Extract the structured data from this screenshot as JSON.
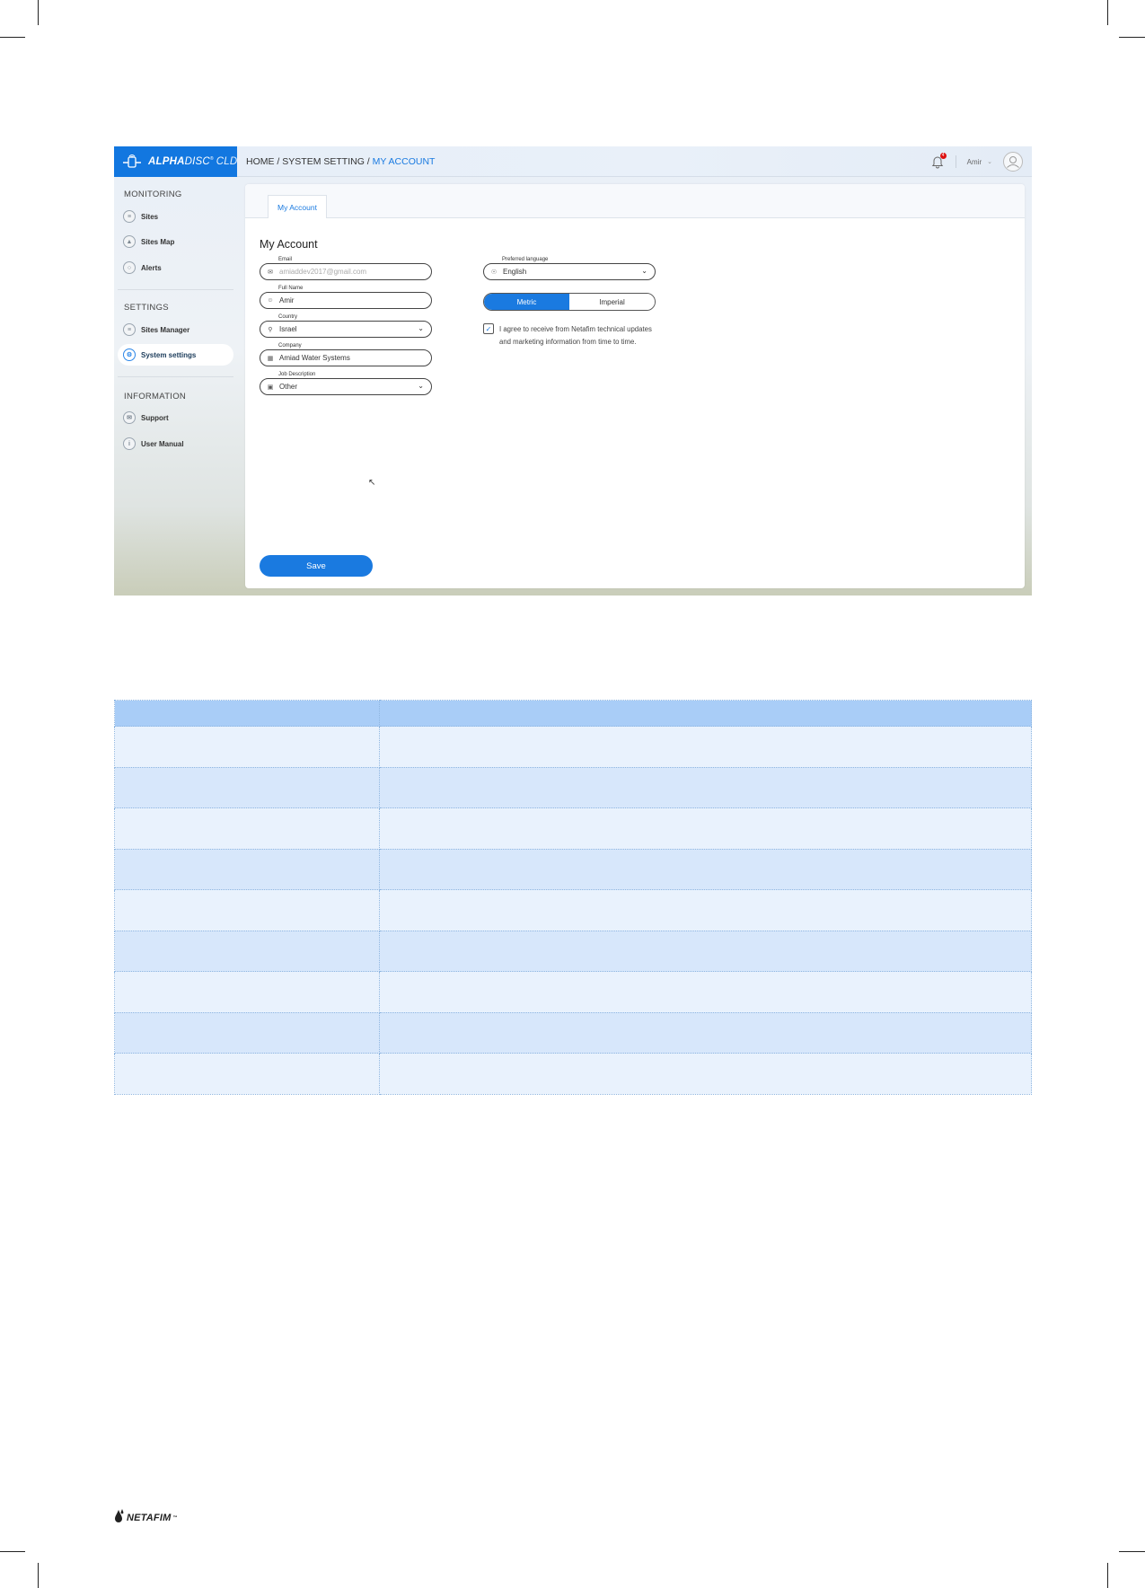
{
  "app": {
    "logo_bold": "ALPHA",
    "logo_disc": "DISC",
    "logo_reg": "®",
    "logo_cld": "CLD",
    "breadcrumb": {
      "home": "HOME",
      "sep1": "/",
      "system": "SYSTEM SETTING",
      "sep2": "/",
      "current": "MY ACCOUNT"
    },
    "notification_count": "4",
    "user_name": "Amir"
  },
  "sidebar": {
    "sections": [
      {
        "title": "MONITORING",
        "items": [
          {
            "label": "Sites",
            "icon": "layers-icon"
          },
          {
            "label": "Sites Map",
            "icon": "map-pin-icon"
          },
          {
            "label": "Alerts",
            "icon": "bell-icon"
          }
        ]
      },
      {
        "title": "SETTINGS",
        "items": [
          {
            "label": "Sites Manager",
            "icon": "layers-icon"
          },
          {
            "label": "System settings",
            "icon": "settings-icon"
          }
        ]
      },
      {
        "title": "INFORMATION",
        "items": [
          {
            "label": "Support",
            "icon": "chat-icon"
          },
          {
            "label": "User Manual",
            "icon": "info-icon"
          }
        ]
      }
    ],
    "selected": "System settings"
  },
  "main": {
    "tab": "My Account",
    "title": "My Account",
    "fields": {
      "email": {
        "label": "Email",
        "value": "amiaddev2017@gmail.com",
        "icon": "mail-icon"
      },
      "full_name": {
        "label": "Full Name",
        "value": "Amir",
        "icon": "user-icon"
      },
      "country": {
        "label": "Country",
        "value": "Israel",
        "icon": "location-icon"
      },
      "company": {
        "label": "Company",
        "value": "Amiad Water Systems",
        "icon": "building-icon"
      },
      "job": {
        "label": "Job Description",
        "value": "Other",
        "icon": "briefcase-icon"
      },
      "language": {
        "label": "Preferred language",
        "value": "English",
        "icon": "globe-icon"
      }
    },
    "units": {
      "metric": "Metric",
      "imperial": "Imperial",
      "selected": "Metric"
    },
    "agree": {
      "checked": true,
      "text": "I agree to receive from Netafim technical updates and marketing information from time to time."
    },
    "save_label": "Save"
  },
  "table": {
    "header": [
      "",
      ""
    ],
    "rows": [
      [
        "",
        ""
      ],
      [
        "",
        ""
      ],
      [
        "",
        ""
      ],
      [
        "",
        ""
      ],
      [
        "",
        ""
      ],
      [
        "",
        ""
      ],
      [
        "",
        ""
      ],
      [
        "",
        ""
      ],
      [
        "",
        ""
      ]
    ]
  },
  "footer": {
    "brand": "NETAFIM",
    "tm": "™"
  }
}
